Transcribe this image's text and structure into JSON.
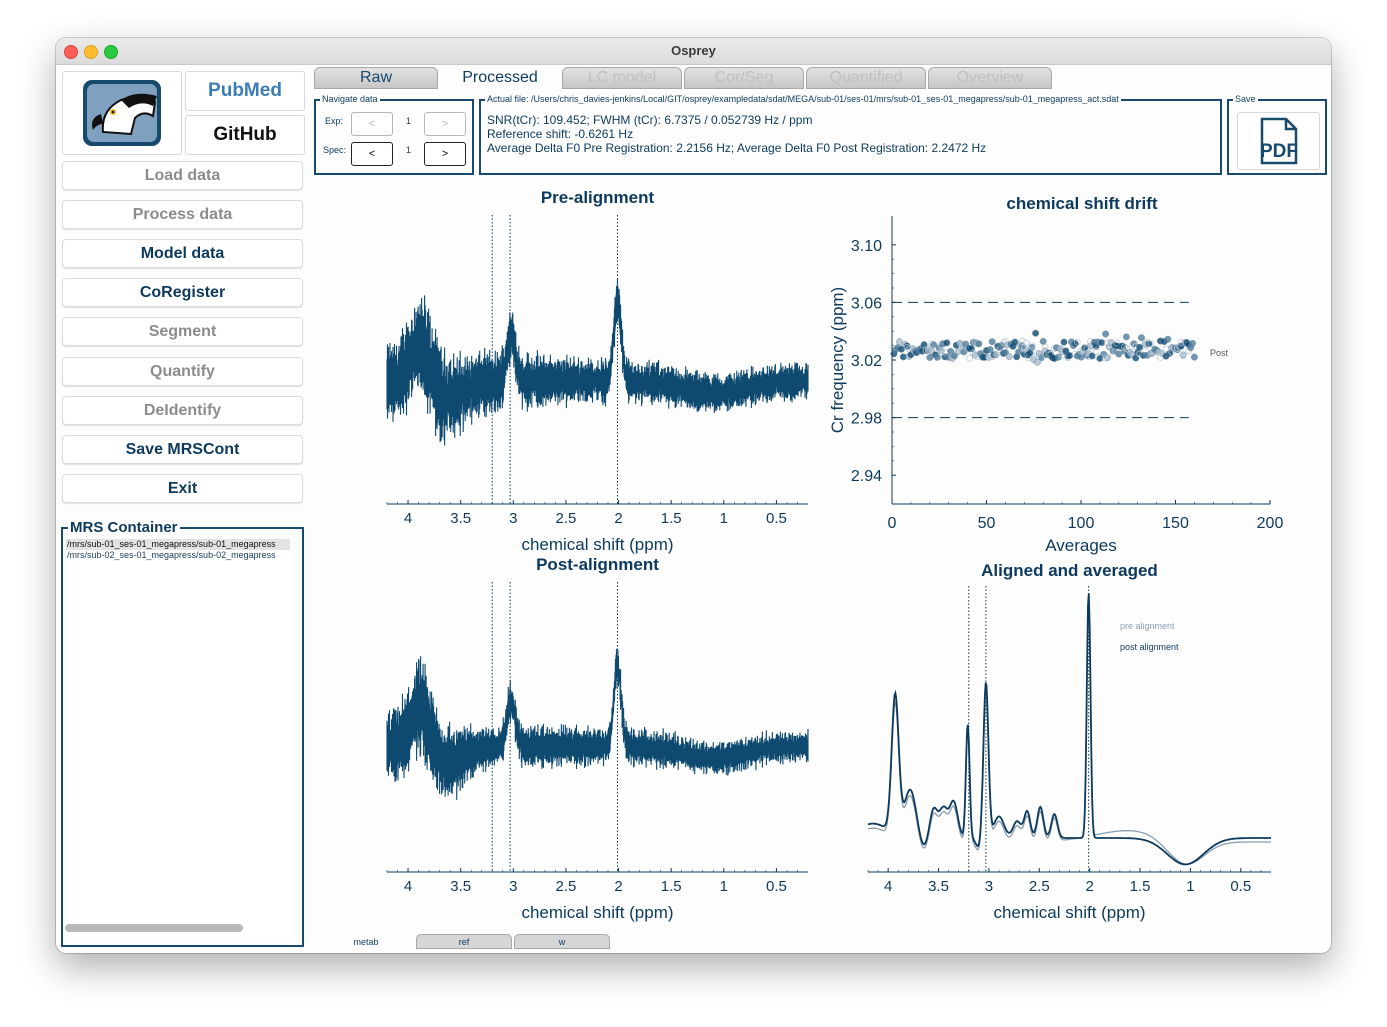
{
  "window": {
    "title": "Osprey"
  },
  "sidebar": {
    "links": {
      "pubmed": "PubMed",
      "github": "GitHub"
    },
    "buttons": [
      {
        "label": "Load data",
        "enabled": false
      },
      {
        "label": "Process data",
        "enabled": false
      },
      {
        "label": "Model data",
        "enabled": true
      },
      {
        "label": "CoRegister",
        "enabled": true
      },
      {
        "label": "Segment",
        "enabled": false
      },
      {
        "label": "Quantify",
        "enabled": false
      },
      {
        "label": "DeIdentify",
        "enabled": false
      },
      {
        "label": "Save MRSCont",
        "enabled": true
      },
      {
        "label": "Exit",
        "enabled": true
      }
    ],
    "container": {
      "title": "MRS Container",
      "items": [
        "/mrs/sub-01_ses-01_megapress/sub-01_megapress",
        "/mrs/sub-02_ses-01_megapress/sub-02_megapress"
      ]
    }
  },
  "tabs": [
    {
      "label": "Raw",
      "active": false
    },
    {
      "label": "Processed",
      "active": true
    },
    {
      "label": "LC model",
      "active": false
    },
    {
      "label": "Cor/Seg",
      "active": false
    },
    {
      "label": "Quantified",
      "active": false
    },
    {
      "label": "Overview",
      "active": false
    }
  ],
  "navigate": {
    "title": "Navigate data",
    "exp_label": "Exp:",
    "spec_label": "Spec:",
    "exp_value": "1",
    "spec_value": "1",
    "prev": "<",
    "next": ">"
  },
  "info": {
    "title": "Actual file: /Users/chris_davies-jenkins/Local/GIT/osprey/exampledata/sdat/MEGA/sub-01/ses-01/mrs/sub-01_ses-01_megapress/sub-01_megapress_act.sdat",
    "lines": [
      "SNR(tCr): 109.452; FWHM (tCr): 6.7375 / 0.052739 Hz / ppm",
      "Reference shift: -0.6261 Hz",
      "Average Delta F0 Pre Registration: 2.2156 Hz; Average Delta F0 Post Registration: 2.2472 Hz"
    ]
  },
  "save": {
    "title": "Save",
    "pdf_label": "PDF"
  },
  "bottom_tabs": [
    {
      "label": "metab",
      "active": true
    },
    {
      "label": "ref",
      "active": false
    },
    {
      "label": "w",
      "active": false
    }
  ],
  "colors": {
    "primary": "#0d3a5c",
    "series": "#0e4a70",
    "pre": "#8a9db0"
  },
  "chart_data": [
    {
      "type": "line",
      "title": "Pre-alignment",
      "xlabel": "chemical shift (ppm)",
      "ylabel": "",
      "x_reversed": true,
      "xlim": [
        4.2,
        0.2
      ],
      "xticks": [
        "4",
        "3.5",
        "3",
        "2.5",
        "2",
        "1.5",
        "1",
        "0.5"
      ],
      "reference_lines_ppm": [
        3.2,
        3.03,
        2.01
      ],
      "peaks_ppm": [
        3.9,
        3.0,
        2.01
      ]
    },
    {
      "type": "scatter",
      "title": "chemical shift drift",
      "xlabel": "Averages",
      "ylabel": "Cr frequency (ppm)",
      "xlim": [
        0,
        200
      ],
      "ylim": [
        2.92,
        3.12
      ],
      "xticks": [
        "0",
        "50",
        "100",
        "150",
        "200"
      ],
      "yticks": [
        "3.10",
        "3.06",
        "3.02",
        "2.98",
        "2.94"
      ],
      "n_points": 160,
      "mean": 3.027,
      "bounds": [
        3.06,
        2.98
      ],
      "annotation": "Post"
    },
    {
      "type": "line",
      "title": "Post-alignment",
      "xlabel": "chemical shift (ppm)",
      "ylabel": "",
      "x_reversed": true,
      "xlim": [
        4.2,
        0.2
      ],
      "xticks": [
        "4",
        "3.5",
        "3",
        "2.5",
        "2",
        "1.5",
        "1",
        "0.5"
      ],
      "reference_lines_ppm": [
        3.2,
        3.03,
        2.01
      ]
    },
    {
      "type": "line",
      "title": "Aligned and averaged",
      "xlabel": "chemical shift (ppm)",
      "ylabel": "",
      "x_reversed": true,
      "xlim": [
        4.2,
        0.2
      ],
      "xticks": [
        "4",
        "3.5",
        "3",
        "2.5",
        "2",
        "1.5",
        "1",
        "0.5"
      ],
      "reference_lines_ppm": [
        3.2,
        3.03,
        2.01
      ],
      "series": [
        {
          "name": "pre alignment",
          "color": "#8a9db0"
        },
        {
          "name": "post alignment",
          "color": "#0d3a5c"
        }
      ],
      "peaks_ppm": [
        3.92,
        3.22,
        3.03,
        2.01
      ]
    }
  ]
}
